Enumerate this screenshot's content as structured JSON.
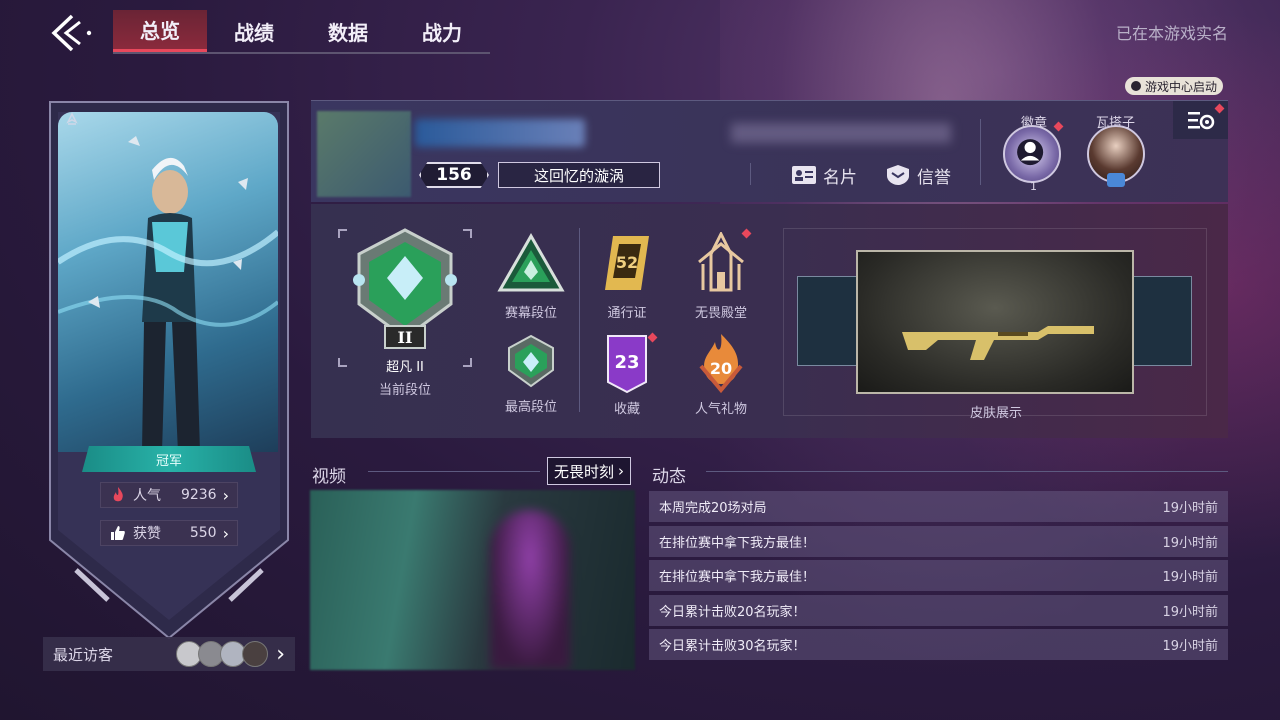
{
  "nav": {
    "tabs": [
      "总览",
      "战绩",
      "数据",
      "战力"
    ],
    "active_tab": 0,
    "realname_text": "已在本游戏实名"
  },
  "hero_card": {
    "rank_label": "冠军",
    "popularity_label": "人气",
    "popularity_value": "9236",
    "likes_label": "获赞",
    "likes_value": "550",
    "recent_visitors_label": "最近访客"
  },
  "profile": {
    "launch_tag": "游戏中心启动",
    "level": "156",
    "title": "这回忆的漩涡",
    "card_button": "名片",
    "credit_button": "信誉",
    "badge_label": "徽章",
    "badge_count": "1",
    "agent_label": "瓦搭子"
  },
  "ranks": {
    "current_rank_name": "超凡 II",
    "current_rank_label": "当前段位",
    "season_rank_label": "赛幕段位",
    "highest_rank_label": "最高段位",
    "pass_label": "通行证",
    "pass_level": "52",
    "collection_label": "收藏",
    "collection_value": "23",
    "hall_label": "无畏殿堂",
    "gift_label": "人气礼物",
    "gift_value": "20",
    "skin_label": "皮肤展示"
  },
  "video": {
    "section_title": "视频",
    "tag": "无畏时刻"
  },
  "feed": {
    "section_title": "动态",
    "items": [
      {
        "text": "本周完成20场对局",
        "time": "19小时前"
      },
      {
        "text": "在排位赛中拿下我方最佳！",
        "time": "19小时前"
      },
      {
        "text": "在排位赛中拿下我方最佳！",
        "time": "19小时前"
      },
      {
        "text": "今日累计击败20名玩家！",
        "time": "19小时前"
      },
      {
        "text": "今日累计击败30名玩家！",
        "time": "19小时前"
      }
    ]
  },
  "colors": {
    "accent_red": "#e8485c",
    "teal": "#28b2a8",
    "rank_green": "#2aa05a",
    "gold": "#e2b850"
  }
}
